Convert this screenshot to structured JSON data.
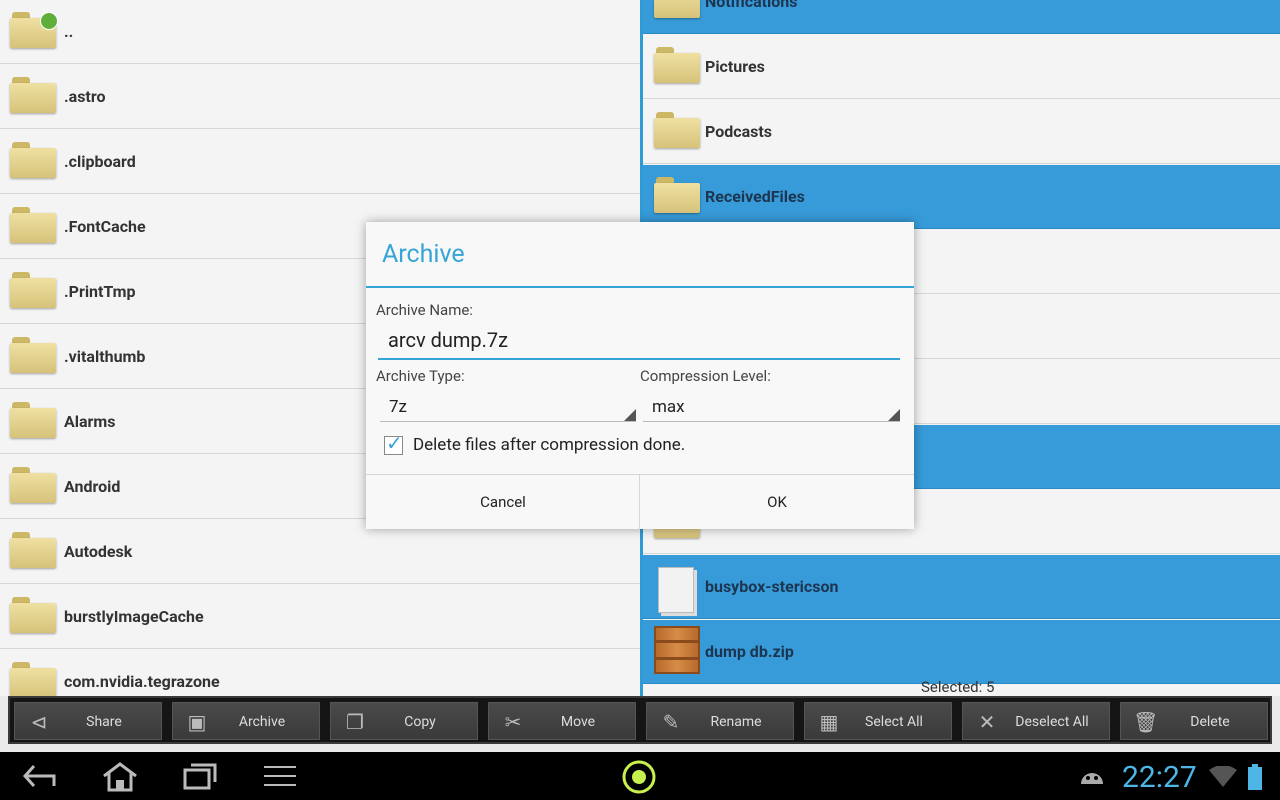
{
  "left_list": [
    {
      "name": "..",
      "icon": "folder-up-icon"
    },
    {
      "name": ".astro",
      "icon": "folder-icon"
    },
    {
      "name": ".clipboard",
      "icon": "folder-icon"
    },
    {
      "name": ".FontCache",
      "icon": "folder-icon"
    },
    {
      "name": ".PrintTmp",
      "icon": "folder-icon"
    },
    {
      "name": ".vitalthumb",
      "icon": "folder-icon"
    },
    {
      "name": "Alarms",
      "icon": "folder-icon"
    },
    {
      "name": "Android",
      "icon": "folder-icon"
    },
    {
      "name": "Autodesk",
      "icon": "folder-icon"
    },
    {
      "name": "burstlyImageCache",
      "icon": "folder-icon"
    },
    {
      "name": "com.nvidia.tegrazone",
      "icon": "folder-icon"
    }
  ],
  "right_list": [
    {
      "name": "Notifications",
      "selected": true
    },
    {
      "name": "Pictures",
      "selected": false
    },
    {
      "name": "Podcasts",
      "selected": false
    },
    {
      "name": "ReceivedFiles",
      "selected": true
    },
    {
      "name": "",
      "selected": false
    },
    {
      "name": "",
      "selected": false
    },
    {
      "name": "",
      "selected": false
    },
    {
      "name": "",
      "selected": true
    },
    {
      "name": "",
      "selected": false
    },
    {
      "name": "busybox-stericson",
      "selected": true
    },
    {
      "name": "dump db.zip",
      "selected": true
    }
  ],
  "selected_count": "Selected: 5",
  "toolbar": {
    "share": "Share",
    "archive": "Archive",
    "copy": "Copy",
    "move": "Move",
    "rename": "Rename",
    "select_all": "Select All",
    "deselect_all": "Deselect All",
    "delete": "Delete"
  },
  "dialog": {
    "title": "Archive",
    "name_label": "Archive Name:",
    "name_value": "arcv dump.7z",
    "type_label": "Archive Type:",
    "type_value": "7z",
    "level_label": "Compression Level:",
    "level_value": "max",
    "checkbox_label": "Delete files after compression done.",
    "checkbox_checked": true,
    "cancel": "Cancel",
    "ok": "OK"
  },
  "status": {
    "clock": "22:27"
  },
  "colors": {
    "accent": "#35a5d5",
    "selection": "#379bd9"
  }
}
